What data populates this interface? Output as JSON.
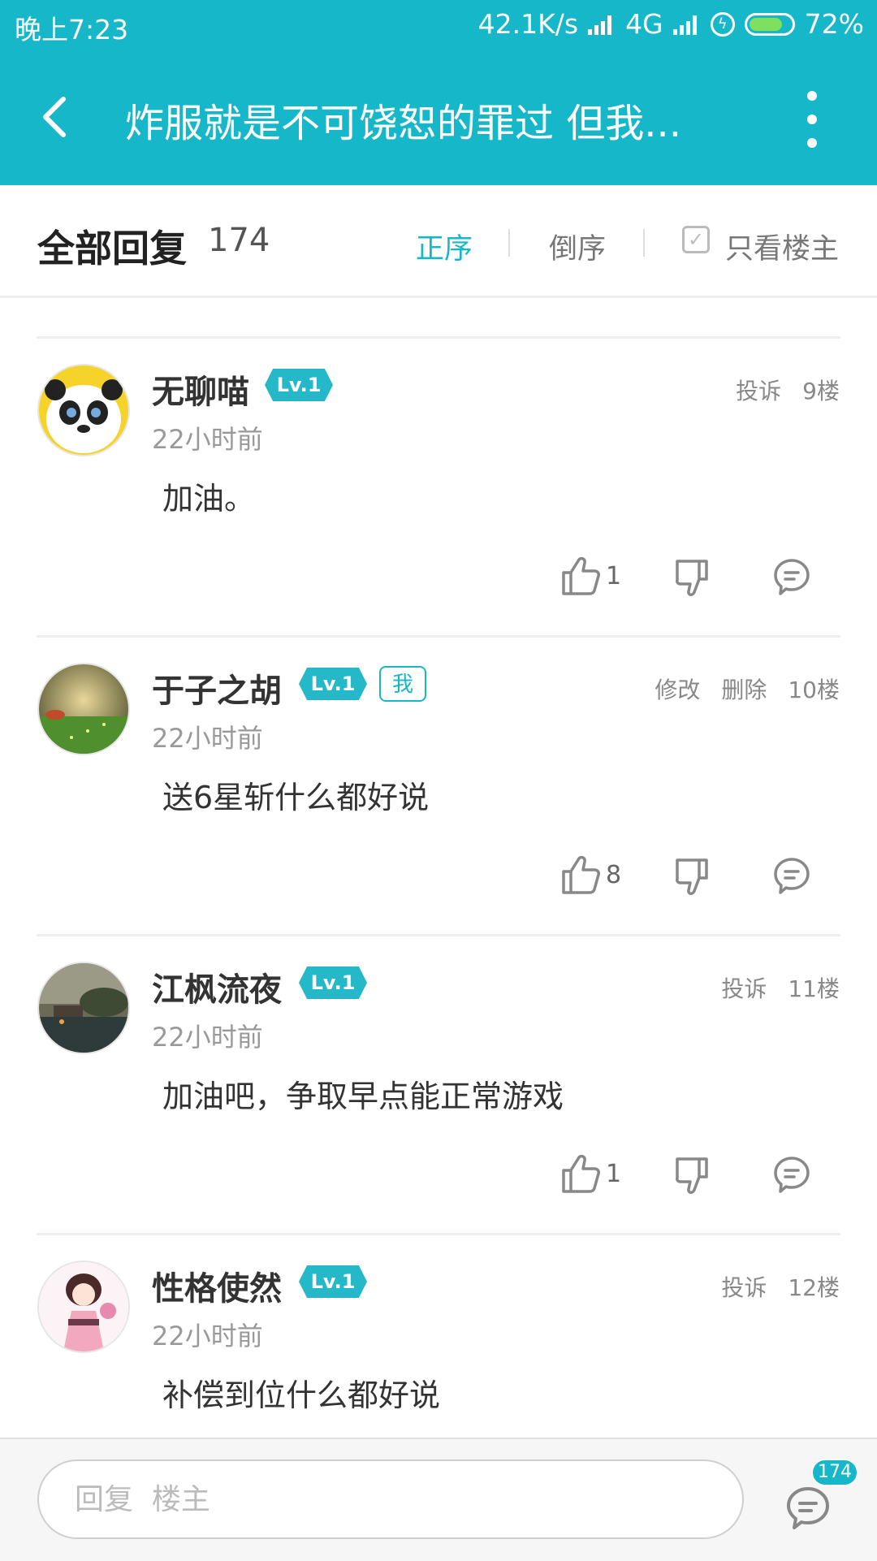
{
  "status_bar": {
    "time": "晚上7:23",
    "net_speed": "42.1K/s",
    "network": "4G",
    "battery": "72%"
  },
  "header": {
    "title": "炸服就是不可饶恕的罪过 但我..."
  },
  "reply_header": {
    "title": "全部回复",
    "count": "174",
    "sort_asc": "正序",
    "sort_desc": "倒序",
    "only_op": "只看楼主"
  },
  "posts": [
    {
      "username": "无聊喵",
      "level": "Lv.1",
      "time": "22小时前",
      "content": "加油。",
      "actions": [
        "投诉"
      ],
      "floor": "9楼",
      "likes": "1"
    },
    {
      "username": "于子之胡",
      "level": "Lv.1",
      "me_badge": "我",
      "time": "22小时前",
      "content": "送6星斩什么都好说",
      "actions": [
        "修改",
        "删除"
      ],
      "floor": "10楼",
      "likes": "8"
    },
    {
      "username": "江枫流夜",
      "level": "Lv.1",
      "time": "22小时前",
      "content": "加油吧，争取早点能正常游戏",
      "actions": [
        "投诉"
      ],
      "floor": "11楼",
      "likes": "1"
    },
    {
      "username": "性格使然",
      "level": "Lv.1",
      "time": "22小时前",
      "content": "补偿到位什么都好说",
      "actions": [
        "投诉"
      ],
      "floor": "12楼"
    }
  ],
  "bottom_bar": {
    "reply_placeholder": "回复  楼主",
    "comment_count": "174"
  },
  "colors": {
    "accent": "#16b7c8",
    "badge": "#24b8c9"
  }
}
